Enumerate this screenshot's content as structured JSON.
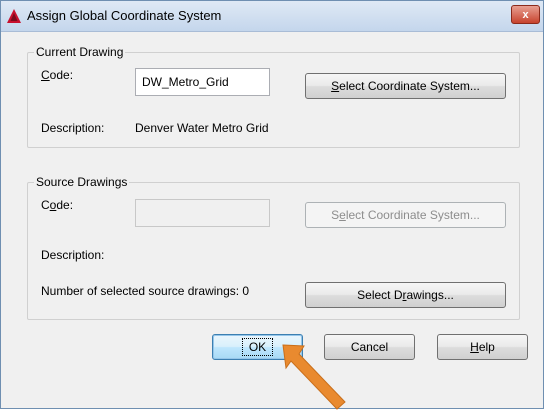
{
  "window": {
    "title": "Assign Global Coordinate System",
    "close_glyph": "x"
  },
  "current_drawing": {
    "group_title": "Current Drawing",
    "code_label_accel": "C",
    "code_label_rest": "ode:",
    "code_value": "DW_Metro_Grid",
    "select_button_accel": "S",
    "select_button_rest": "elect Coordinate System...",
    "description_label": "Description:",
    "description_value": "Denver Water Metro Grid"
  },
  "source_drawings": {
    "group_title": "Source Drawings",
    "code_label_pre": "C",
    "code_label_accel": "o",
    "code_label_rest": "de:",
    "code_value": "",
    "select_button_pre": "S",
    "select_button_accel": "e",
    "select_button_rest": "lect Coordinate System...",
    "description_label": "Description:",
    "count_label": "Number of selected source drawings: 0",
    "select_drawings_pre": "Select D",
    "select_drawings_accel": "r",
    "select_drawings_rest": "awings..."
  },
  "buttons": {
    "ok": "OK",
    "cancel": "Cancel",
    "help_accel": "H",
    "help_rest": "elp"
  },
  "colors": {
    "arrow": "#e98a2f",
    "titlebar": "#c4d6ec",
    "default_button_border": "#3c7fb1"
  }
}
